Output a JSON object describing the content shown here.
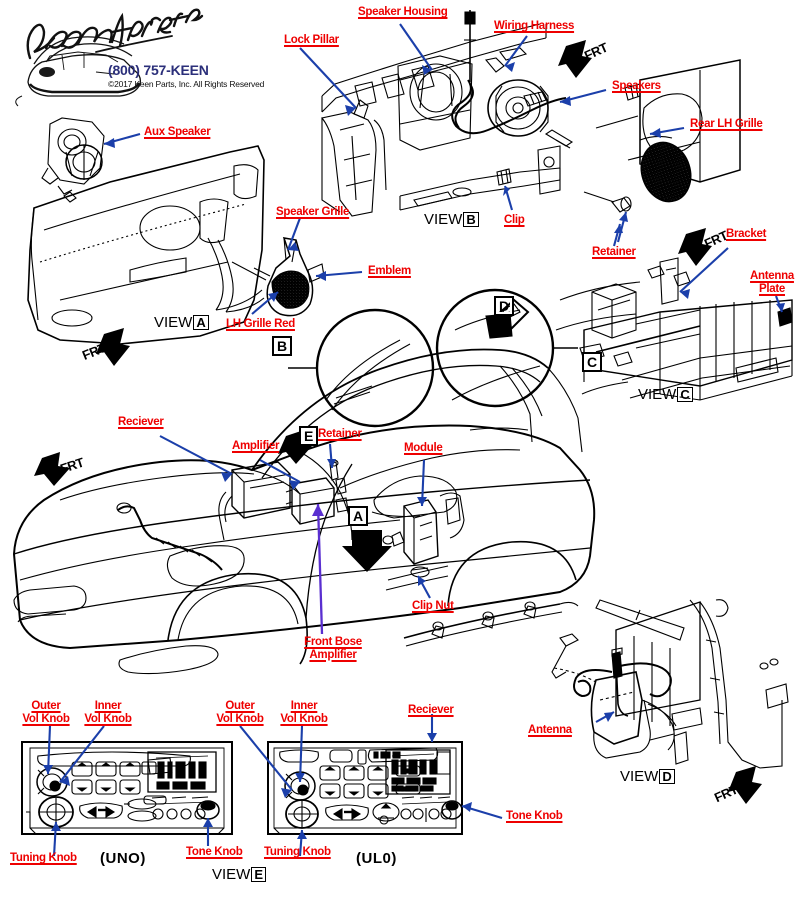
{
  "header": {
    "brand": "Keen Parts",
    "phone": "(800) 757-KEEN",
    "copyright": "©2017 Keen Parts, Inc. All Rights Reserved"
  },
  "labels": {
    "speaker_housing": "Speaker Housing",
    "wiring_harness": "Wiring Harness",
    "lock_pillar": "Lock Pillar",
    "speakers": "Speakers",
    "rear_lh_grille": "Rear LH Grille",
    "aux_speaker": "Aux Speaker",
    "speaker_grille": "Speaker Grille",
    "emblem": "Emblem",
    "lh_grille_red": "LH Grille Red",
    "clip": "Clip",
    "retainer_b": "Retainer",
    "bracket": "Bracket",
    "antenna_plate_l1": "Antenna",
    "antenna_plate_l2": "Plate",
    "reciever_car": "Reciever",
    "amplifier": "Amplifier",
    "retainer_car": "Retainer",
    "module": "Module",
    "clip_nut": "Clip Nut",
    "front_bose_l1": "Front Bose",
    "front_bose_l2": "Amplifier",
    "antenna": "Antenna",
    "outer_vol_knob_l1": "Outer",
    "outer_vol_knob_l2": "Vol Knob",
    "inner_vol_knob_l1": "Inner",
    "inner_vol_knob_l2": "Vol Knob",
    "tuning_knob": "Tuning Knob",
    "tone_knob": "Tone Knob",
    "reciever_radio": "Reciever"
  },
  "views": {
    "view_word": "VIEW",
    "a": "A",
    "b": "B",
    "c": "C",
    "d": "D",
    "e": "E"
  },
  "callout_boxes": {
    "b": "B",
    "c": "C",
    "a_car": "A",
    "e_car": "E",
    "d_car": "D"
  },
  "direction": {
    "frt": "FRT"
  },
  "radio_codes": {
    "uno": "(UNO)",
    "ul0": "(UL0)"
  },
  "colors": {
    "label_red": "#ee0000",
    "arrow_blue": "#1b3faa",
    "arrow_purple": "#5a2fd0",
    "phone_blue": "#2b2f7a",
    "line_black": "#000000",
    "background": "#ffffff"
  }
}
